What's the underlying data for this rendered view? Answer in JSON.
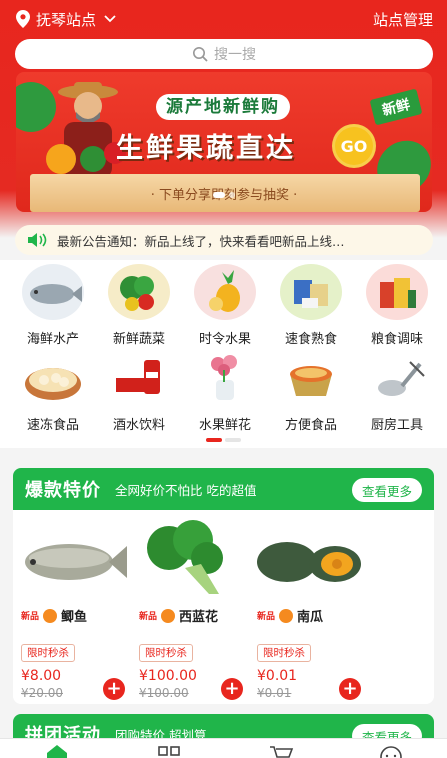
{
  "header": {
    "location": "抚琴站点",
    "manage_label": "站点管理",
    "search_placeholder": "搜一搜"
  },
  "banner": {
    "title1": "源产地新鲜购",
    "title2": "生鲜果蔬直达",
    "go_label": "GO",
    "new_tag": "新鲜",
    "subtitle": "· 下单分享即刻参与抽奖 ·"
  },
  "notice": {
    "text": "最新公告通知：新品上线了，快来看看吧新品上线…"
  },
  "categories": [
    {
      "label": "海鲜水产",
      "icon": "fish-icon"
    },
    {
      "label": "新鲜蔬菜",
      "icon": "vegetable-icon"
    },
    {
      "label": "时令水果",
      "icon": "fruit-icon"
    },
    {
      "label": "速食熟食",
      "icon": "instant-food-icon"
    },
    {
      "label": "粮食调味",
      "icon": "grain-icon"
    },
    {
      "label": "速冻食品",
      "icon": "dumpling-icon"
    },
    {
      "label": "酒水饮料",
      "icon": "drink-icon"
    },
    {
      "label": "水果鲜花",
      "icon": "flower-icon"
    },
    {
      "label": "方便食品",
      "icon": "noodle-icon"
    },
    {
      "label": "厨房工具",
      "icon": "kitchen-tool-icon"
    }
  ],
  "hot": {
    "title": "爆款特价",
    "subtitle": "全网好价不怕比 吃的超值",
    "more_label": "查看更多",
    "products": [
      {
        "name": "鲫鱼",
        "tag_new": "新品",
        "flash": "限时秒杀",
        "price": "¥8.00",
        "old_price": "¥20.00"
      },
      {
        "name": "西蓝花",
        "tag_new": "新品",
        "flash": "限时秒杀",
        "price": "¥100.00",
        "old_price": "¥100.00"
      },
      {
        "name": "南瓜",
        "tag_new": "新品",
        "flash": "限时秒杀",
        "price": "¥0.01",
        "old_price": "¥0.01"
      }
    ]
  },
  "group": {
    "title": "拼团活动",
    "subtitle": "团购特价 超划算",
    "more_label": "查看更多"
  },
  "colors": {
    "brand_red": "#e8261e",
    "brand_green": "#20b54a"
  }
}
